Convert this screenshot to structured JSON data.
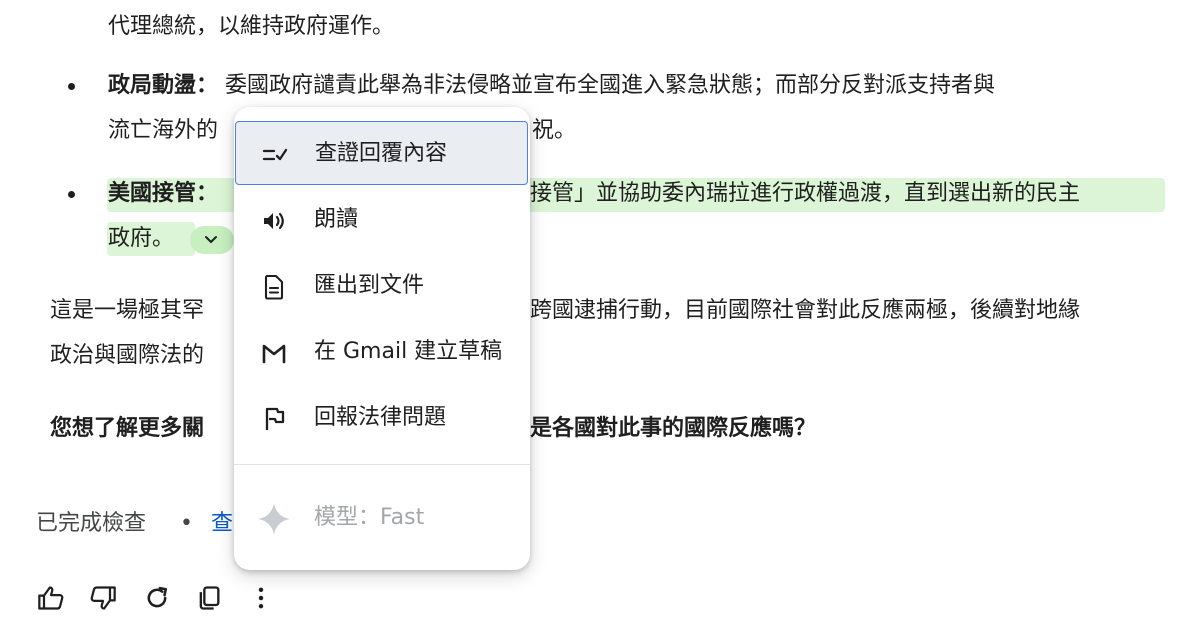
{
  "content": {
    "line_top": "代理總統，以維持政府運作。",
    "bullet2_label": "政局動盪：",
    "bullet2_text": " 委國政府譴責此舉為非法侵略並宣布全國進入緊急狀態；而部分反對派支持者與",
    "bullet2_line2a": "流亡海外的",
    "bullet2_line2b": "祝。",
    "bullet3_label": "美國接管：",
    "bullet3_text": "接管」並協助委內瑞拉進行政權過渡，直到選出新的民主",
    "bullet3_line2": "政府。",
    "para_a": "這是一場極其罕",
    "para_b": "跨國逮捕行動，目前國際社會對此反應兩極，後續對地緣",
    "para_line2": "政治與國際法的",
    "question_a": "您想了解更多關",
    "question_b": "是各國對此事的國際反應嗎？",
    "status_text": "已完成檢查",
    "status_sep": "•",
    "status_link": "查"
  },
  "menu": {
    "items": [
      {
        "label": "查證回覆內容",
        "icon": "double-check-icon"
      },
      {
        "label": "朗讀",
        "icon": "speaker-icon"
      },
      {
        "label": "匯出到文件",
        "icon": "document-icon"
      },
      {
        "label": "在 Gmail 建立草稿",
        "icon": "gmail-icon"
      },
      {
        "label": "回報法律問題",
        "icon": "flag-icon"
      }
    ],
    "model_label": "模型：Fast",
    "model_icon": "sparkle-icon"
  },
  "actions": {
    "icons": [
      "thumb-up-icon",
      "thumb-down-icon",
      "redo-icon",
      "copy-icon",
      "more-vert-icon"
    ]
  },
  "colors": {
    "highlight": "#dcf5d6",
    "link": "#0b57d0",
    "active_border": "#4c7de8"
  }
}
